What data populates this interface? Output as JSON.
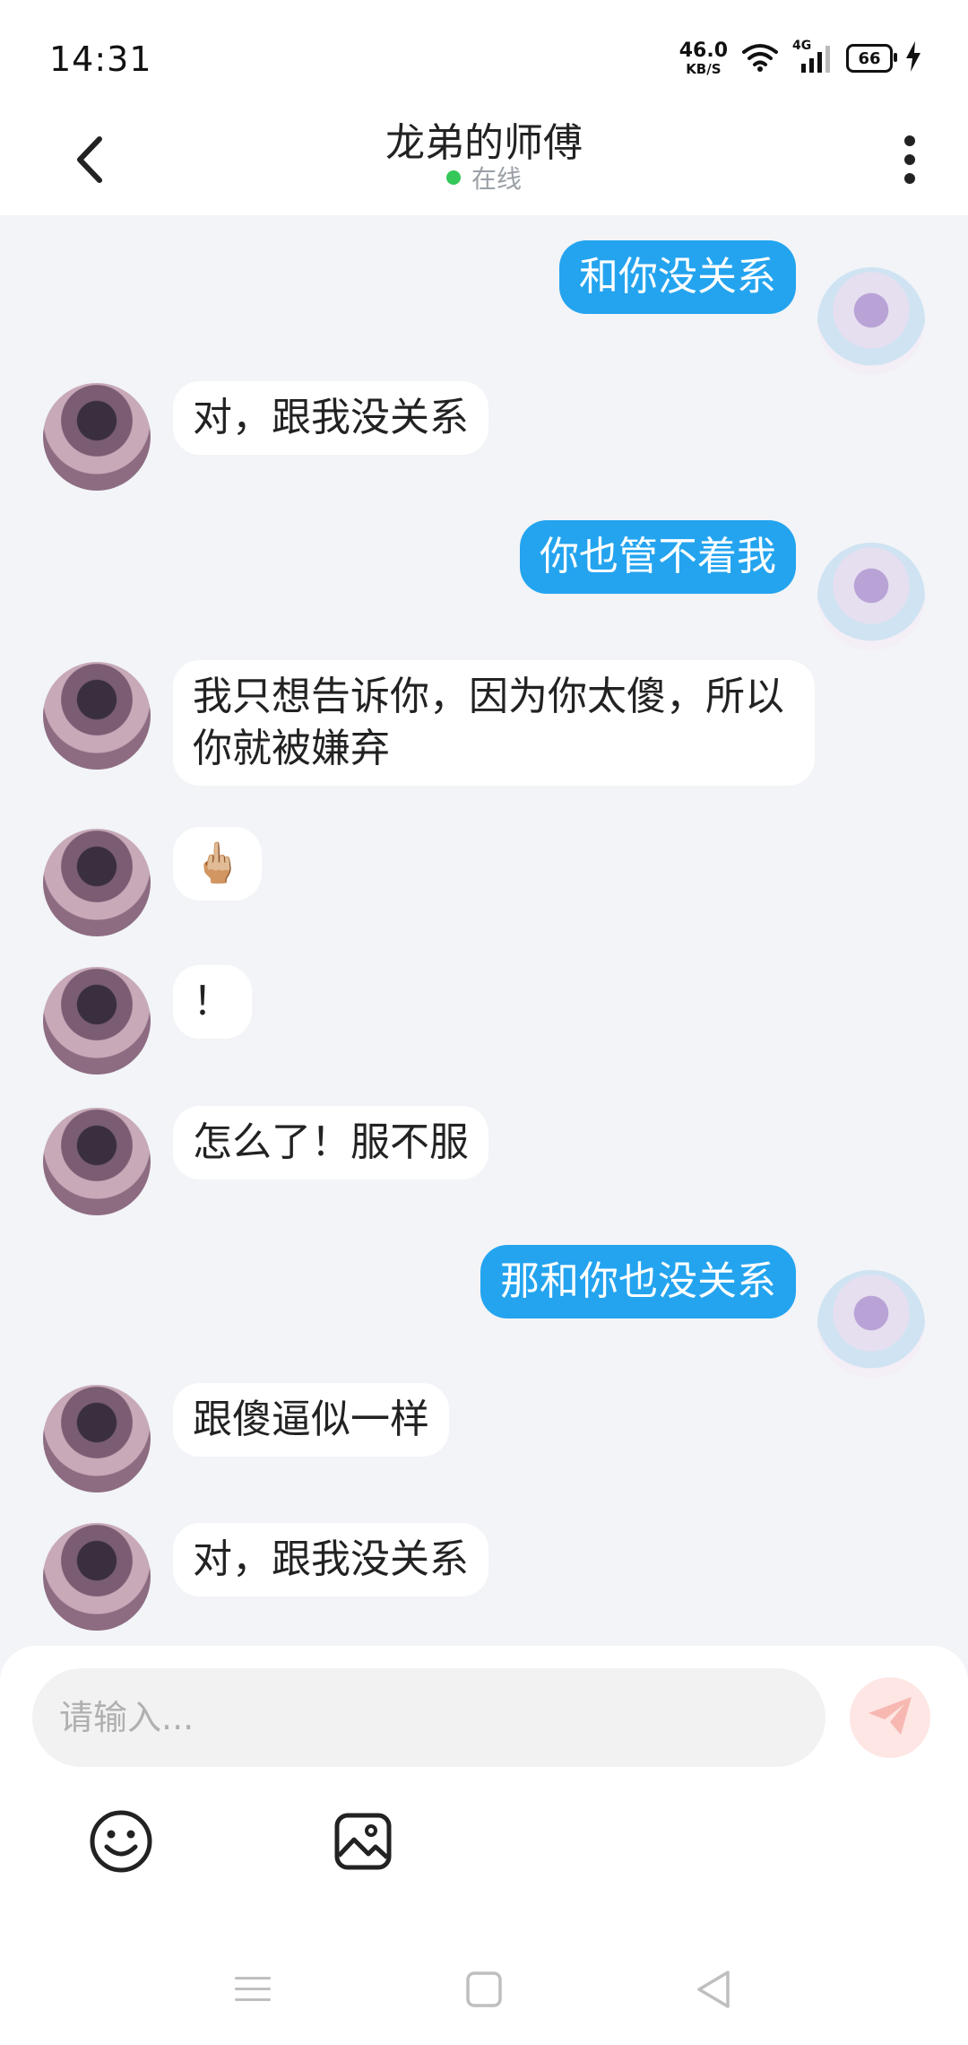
{
  "status_bar": {
    "time": "14:31",
    "net_speed_value": "46.0",
    "net_speed_unit": "KB/S",
    "network_type": "4G",
    "battery": "66"
  },
  "header": {
    "title": "龙弟的师傅",
    "presence": "在线",
    "presence_color": "#34c759"
  },
  "messages": [
    {
      "side": "self",
      "text": "和你没关系"
    },
    {
      "side": "other",
      "text": "对，跟我没关系"
    },
    {
      "side": "self",
      "text": "你也管不着我"
    },
    {
      "side": "other",
      "text": "我只想告诉你，因为你太傻，所以你就被嫌弃"
    },
    {
      "side": "other",
      "text": "🖕🏼"
    },
    {
      "side": "other",
      "text": "！"
    },
    {
      "side": "other",
      "text": "怎么了！服不服"
    },
    {
      "side": "self",
      "text": "那和你也没关系"
    },
    {
      "side": "other",
      "text": "跟傻逼似一样"
    },
    {
      "side": "other",
      "text": "对，跟我没关系"
    }
  ],
  "composer": {
    "placeholder": "请输入..."
  },
  "colors": {
    "self_bubble": "#24a4ef",
    "other_bubble": "#ffffff",
    "background": "#f2f4f7"
  },
  "icons": {
    "back": "chevron-left-icon",
    "more": "more-vertical-icon",
    "send": "paper-plane-icon",
    "emoji": "smiley-icon",
    "image": "image-icon",
    "nav_menu": "menu-icon",
    "nav_home": "square-icon",
    "nav_back": "triangle-left-icon"
  }
}
